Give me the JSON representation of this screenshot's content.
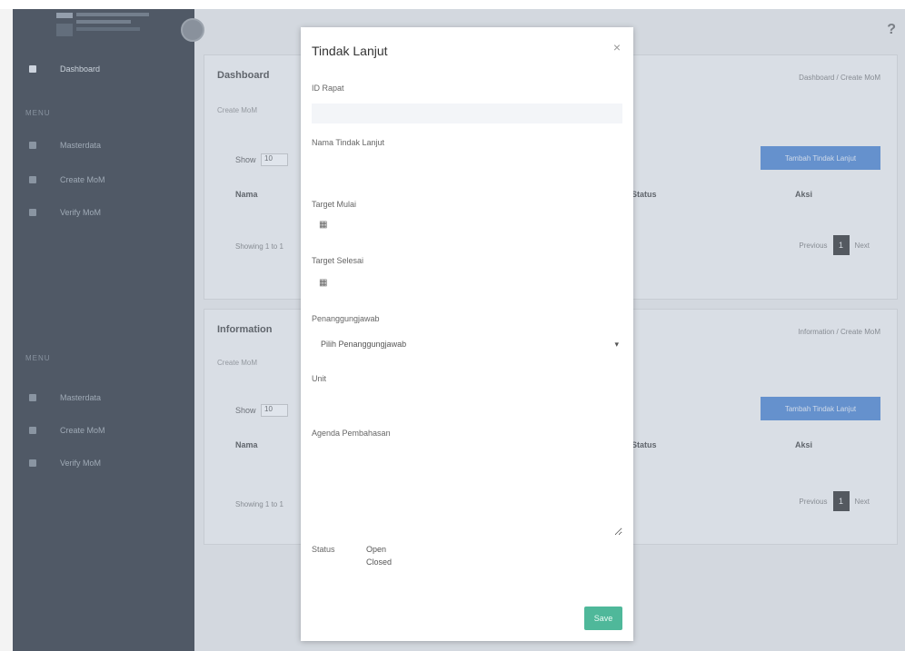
{
  "sidebar": {
    "sections": [
      {
        "heading": "MENU",
        "items": [
          {
            "label": "Dashboard",
            "active": true
          },
          {
            "label": "Masterdata"
          },
          {
            "label": "Create MoM"
          },
          {
            "label": "Verify MoM"
          }
        ]
      },
      {
        "heading": "MENU",
        "items": [
          {
            "label": "Masterdata"
          },
          {
            "label": "Create MoM"
          },
          {
            "label": "Verify MoM"
          }
        ]
      }
    ]
  },
  "main": {
    "help_icon": "?",
    "cards": [
      {
        "title": "Dashboard",
        "breadcrumb": "Dashboard / Create MoM",
        "subtitle": "Create MoM",
        "show_label": "Show",
        "show_value": "10",
        "add_button": "Tambah Tindak Lanjut",
        "columns": [
          "Nama",
          "Status",
          "Aksi"
        ],
        "showing_text": "Showing 1 to 1",
        "pager": {
          "prev": "Previous",
          "page": "1",
          "next": "Next"
        }
      },
      {
        "title": "Information",
        "breadcrumb": "Information / Create MoM",
        "subtitle": "Create MoM",
        "show_label": "Show",
        "show_value": "10",
        "add_button": "Tambah Tindak Lanjut",
        "columns": [
          "Nama",
          "Status",
          "Aksi"
        ],
        "showing_text": "Showing 1 to 1",
        "pager": {
          "prev": "Previous",
          "page": "1",
          "next": "Next"
        }
      }
    ]
  },
  "modal": {
    "title": "Tindak Lanjut",
    "close_icon": "×",
    "fields": {
      "id_rapat": {
        "label": "ID Rapat",
        "value": ""
      },
      "nama_tindak_lanjut": {
        "label": "Nama Tindak Lanjut",
        "value": ""
      },
      "target_mulai": {
        "label": "Target Mulai",
        "icon": "calendar-icon"
      },
      "target_selesai": {
        "label": "Target Selesai",
        "icon": "calendar-icon"
      },
      "penanggungjawab": {
        "label": "Penanggungjawab",
        "selected": "Pilih Penanggungjawab"
      },
      "unit": {
        "label": "Unit",
        "value": ""
      },
      "agenda": {
        "label": "Agenda Pembahasan",
        "value": ""
      },
      "status": {
        "label": "Status",
        "options": [
          "Open",
          "Closed"
        ]
      }
    },
    "save_button": "Save"
  },
  "colors": {
    "sidebar_bg": "#3f454c",
    "primary_button": "#5b8fd6",
    "save_button": "#4fb89a",
    "overlay": "rgba(130,150,180,0.25)"
  }
}
